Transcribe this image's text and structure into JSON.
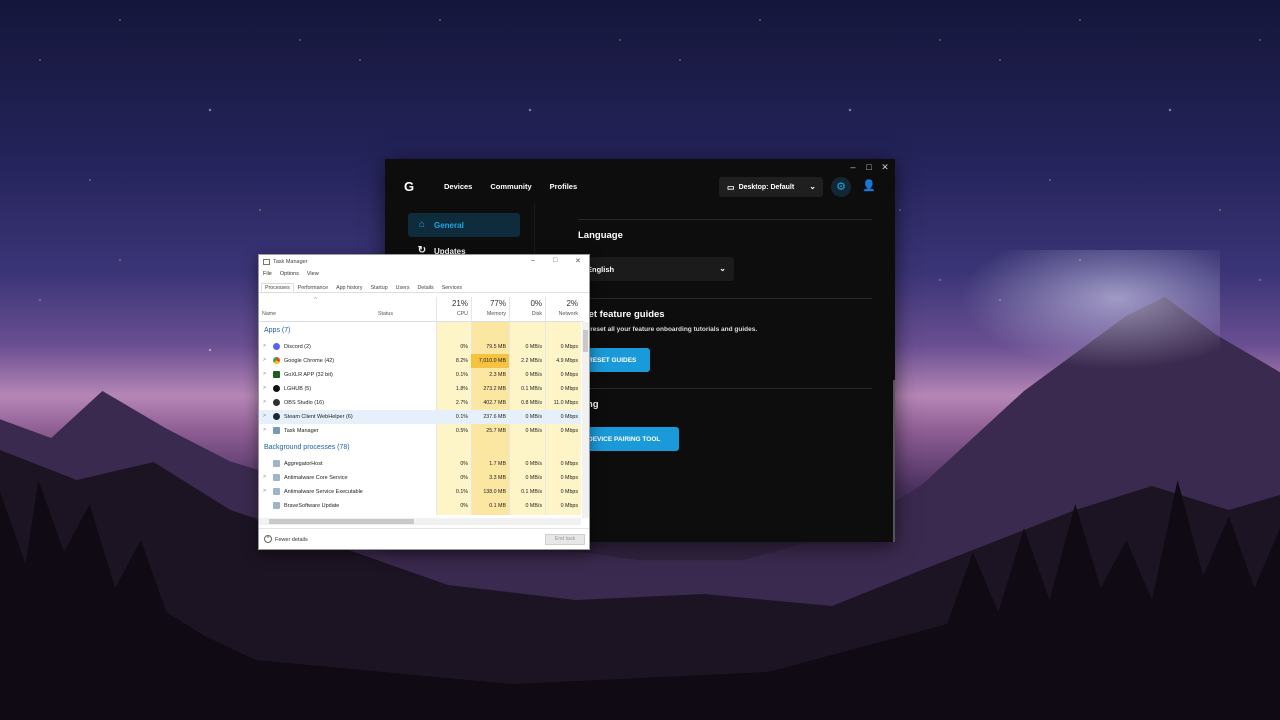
{
  "colors": {
    "ghub_bg": "#0d0d0d",
    "ghub_accent": "#19a8e8",
    "ghub_button": "#1a9ad8",
    "taskmgr_bg": "#ffffff",
    "taskmgr_section": "#1f5fa8",
    "taskmgr_mem_high": "#f5c242"
  },
  "ghub": {
    "nav": [
      "Devices",
      "Community",
      "Profiles"
    ],
    "profile_select": "Desktop: Default",
    "sidebar": [
      {
        "label": "General",
        "icon": "home-icon",
        "active": true
      },
      {
        "label": "Updates",
        "icon": "refresh-icon",
        "active": false
      }
    ],
    "language": {
      "heading": "Language",
      "value": "English"
    },
    "guides": {
      "heading": "Reset feature guides",
      "visible_heading": "eset feature guides",
      "desc": "will reset all your feature onboarding tutorials and guides.",
      "button": "RESET GUIDES"
    },
    "pairing": {
      "heading": "iring",
      "button": "DEVICE PAIRING TOOL"
    }
  },
  "taskmgr": {
    "title": "Task Manager",
    "menu": [
      "File",
      "Options",
      "View"
    ],
    "tabs": [
      "Processes",
      "Performance",
      "App history",
      "Startup",
      "Users",
      "Details",
      "Services"
    ],
    "columns": {
      "name": "Name",
      "status": "Status",
      "cpu": {
        "pct": "21%",
        "label": "CPU"
      },
      "memory": {
        "pct": "77%",
        "label": "Memory"
      },
      "disk": {
        "pct": "0%",
        "label": "Disk"
      },
      "network": {
        "pct": "2%",
        "label": "Network"
      }
    },
    "apps_heading": "Apps (7)",
    "apps": [
      {
        "name": "Discord (2)",
        "cpu": "0%",
        "mem": "79.5 MB",
        "disk": "0 MB/s",
        "net": "0 Mbps",
        "icon": "discord-icon"
      },
      {
        "name": "Google Chrome (42)",
        "cpu": "8.2%",
        "mem": "7,010.0 MB",
        "disk": "2.2 MB/s",
        "net": "4.9 Mbps",
        "icon": "chrome-icon"
      },
      {
        "name": "GoXLR APP (32 bit)",
        "cpu": "0.1%",
        "mem": "2.3 MB",
        "disk": "0 MB/s",
        "net": "0 Mbps",
        "icon": "goxlr-icon"
      },
      {
        "name": "LGHUB (5)",
        "cpu": "1.8%",
        "mem": "273.2 MB",
        "disk": "0.1 MB/s",
        "net": "0 Mbps",
        "icon": "lghub-icon"
      },
      {
        "name": "OBS Studio (16)",
        "cpu": "2.7%",
        "mem": "402.7 MB",
        "disk": "0.8 MB/s",
        "net": "11.0 Mbps",
        "icon": "obs-icon"
      },
      {
        "name": "Steam Client WebHelper (6)",
        "cpu": "0.1%",
        "mem": "237.6 MB",
        "disk": "0 MB/s",
        "net": "0 Mbps",
        "icon": "steam-icon"
      },
      {
        "name": "Task Manager",
        "cpu": "0.5%",
        "mem": "25.7 MB",
        "disk": "0 MB/s",
        "net": "0 Mbps",
        "icon": "task-manager-icon"
      }
    ],
    "bg_heading": "Background processes (78)",
    "background": [
      {
        "name": "AggregatorHost",
        "cpu": "0%",
        "mem": "1.7 MB",
        "disk": "0 MB/s",
        "net": "0 Mbps"
      },
      {
        "name": "Antimalware Core Service",
        "cpu": "0%",
        "mem": "3.3 MB",
        "disk": "0 MB/s",
        "net": "0 Mbps"
      },
      {
        "name": "Antimalware Service Executable",
        "cpu": "0.1%",
        "mem": "138.0 MB",
        "disk": "0.1 MB/s",
        "net": "0 Mbps"
      },
      {
        "name": "BraveSoftware Update",
        "cpu": "0%",
        "mem": "0.1 MB",
        "disk": "0 MB/s",
        "net": "0 Mbps"
      }
    ],
    "fewer_details": "Fewer details",
    "end_task": "End task"
  }
}
